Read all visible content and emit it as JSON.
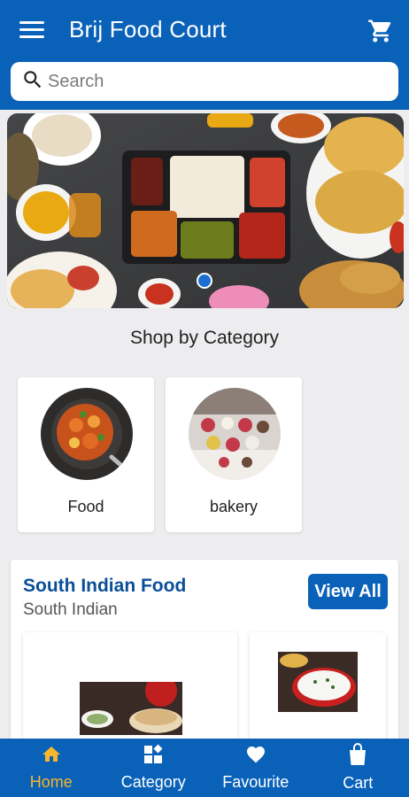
{
  "header": {
    "title": "Brij Food Court",
    "menu_icon": "hamburger-menu-icon",
    "cart_icon": "shopping-cart-icon"
  },
  "search": {
    "placeholder": "Search",
    "icon": "search-icon"
  },
  "banner": {
    "slide_count": 1,
    "active_slide": 0
  },
  "categories": {
    "title": "Shop by Category",
    "items": [
      {
        "label": "Food"
      },
      {
        "label": "bakery"
      }
    ]
  },
  "product_section": {
    "title": "South Indian Food",
    "subtitle": "South Indian",
    "view_all_label": "View All",
    "products": [
      {
        "name": ""
      },
      {
        "name": ""
      }
    ]
  },
  "bottom_nav": {
    "items": [
      {
        "label": "Home",
        "icon": "home-icon",
        "active": true
      },
      {
        "label": "Category",
        "icon": "category-grid-icon",
        "active": false
      },
      {
        "label": "Favourite",
        "icon": "heart-icon",
        "active": false
      },
      {
        "label": "Cart",
        "icon": "shopping-bag-icon",
        "active": false
      }
    ]
  },
  "colors": {
    "primary": "#0a62b8",
    "active_nav": "#f7b62b",
    "background": "#ededf0"
  }
}
